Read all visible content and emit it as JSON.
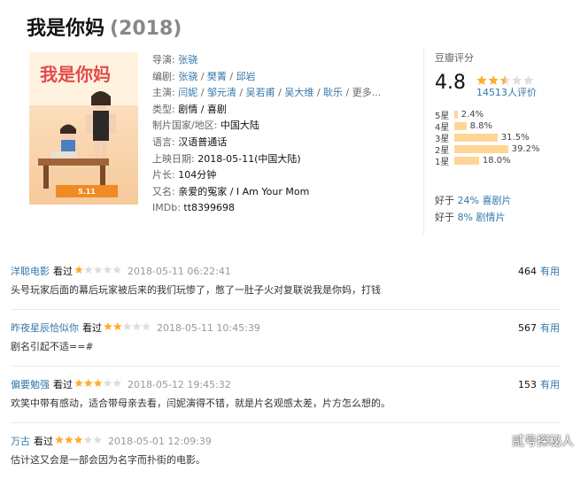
{
  "movie": {
    "title": "我是你妈",
    "year": "(2018)"
  },
  "info": {
    "director_label": "导演:",
    "director": [
      "张骁"
    ],
    "writer_label": "编剧:",
    "writers": [
      "张骁",
      "樊菁",
      "邱岩"
    ],
    "cast_label": "主演:",
    "cast": [
      "闫妮",
      "邹元清",
      "吴若甫",
      "吴大维",
      "耿乐"
    ],
    "cast_more": "更多...",
    "genre_label": "类型:",
    "genres": "剧情 / 喜剧",
    "country_label": "制片国家/地区:",
    "country": "中国大陆",
    "language_label": "语言:",
    "language": "汉语普通话",
    "release_label": "上映日期:",
    "release": "2018-05-11(中国大陆)",
    "runtime_label": "片长:",
    "runtime": "104分钟",
    "aka_label": "又名:",
    "aka": "亲爱的冤家 / I Am Your Mom",
    "imdb_label": "IMDb:",
    "imdb": "tt8399698"
  },
  "rating": {
    "label": "豆瓣评分",
    "score": "4.8",
    "stars_fraction": 0.5,
    "count": "14513人评价",
    "distribution": [
      {
        "label": "5星",
        "percent": 2.4,
        "text": "2.4%"
      },
      {
        "label": "4星",
        "percent": 8.8,
        "text": "8.8%"
      },
      {
        "label": "3星",
        "percent": 31.5,
        "text": "31.5%"
      },
      {
        "label": "2星",
        "percent": 39.2,
        "text": "39.2%"
      },
      {
        "label": "1星",
        "percent": 18.0,
        "text": "18.0%"
      }
    ],
    "better_than": [
      {
        "prefix": "好于 ",
        "pct": "24% 喜剧片"
      },
      {
        "prefix": "好于 ",
        "pct": "8% 剧情片"
      }
    ]
  },
  "comments": [
    {
      "user": "洋聪电影",
      "watched": "看过",
      "stars": 1,
      "time": "2018-05-11 06:22:41",
      "votes": "464",
      "useful": "有用",
      "text": "头号玩家后面的幕后玩家被后来的我们玩惨了，憋了一肚子火对复联说我是你妈，打钱"
    },
    {
      "user": "昨夜星辰恰似你",
      "watched": "看过",
      "stars": 2,
      "time": "2018-05-11 10:45:39",
      "votes": "567",
      "useful": "有用",
      "text": "剧名引起不适==#"
    },
    {
      "user": "偏要勉强",
      "watched": "看过",
      "stars": 3,
      "time": "2018-05-12 19:45:32",
      "votes": "153",
      "useful": "有用",
      "text": "欢笑中带有感动，适合带母亲去看，闫妮演得不错，就是片名观感太差，片方怎么想的。"
    },
    {
      "user": "万古",
      "watched": "看过",
      "stars": 3,
      "time": "2018-05-01 12:09:39",
      "votes": "",
      "useful": "",
      "text": "估计这又会是一部会因为名字而扑街的电影。"
    }
  ],
  "watermark": "贰号探秘人",
  "colors": {
    "link": "#3377aa",
    "star": "#ffac2d",
    "bar": "#ffd596"
  }
}
